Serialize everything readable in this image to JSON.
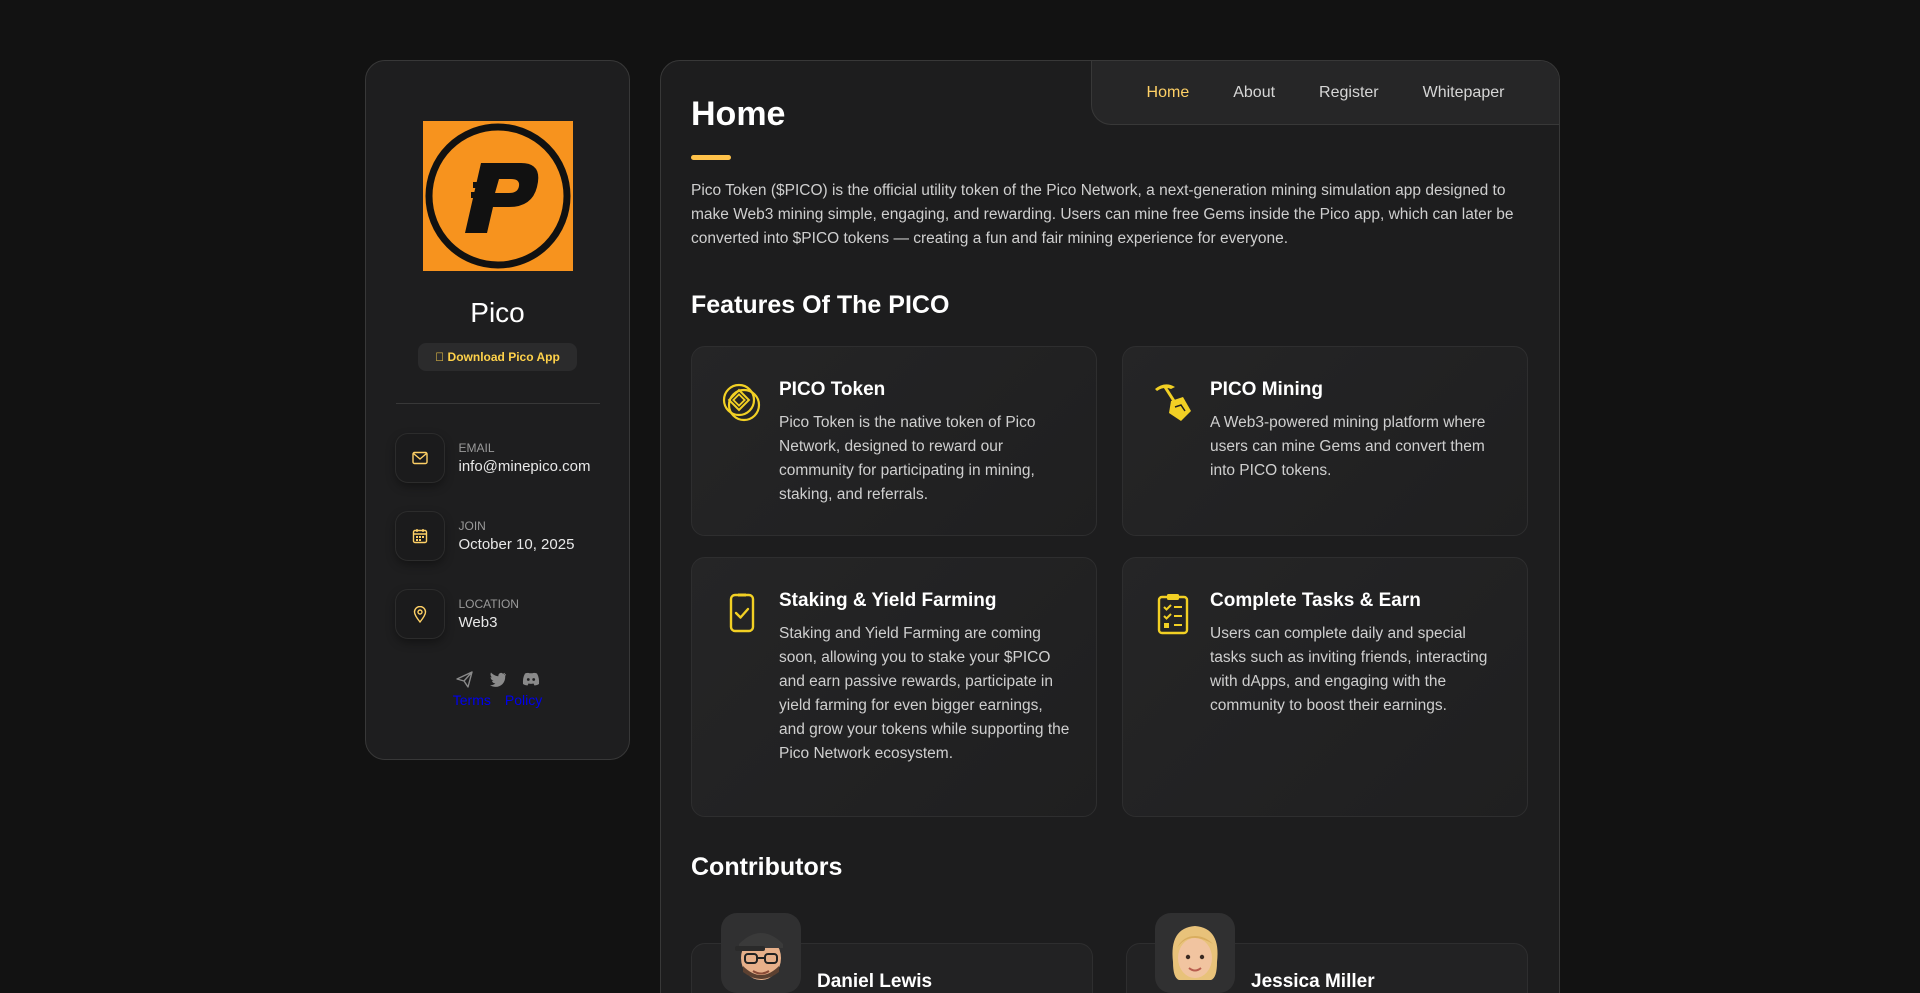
{
  "profile": {
    "name": "Pico",
    "download_label": " Download Pico App",
    "contacts": [
      {
        "title": "EMAIL",
        "value": "info@minepico.com",
        "icon": "mail-icon"
      },
      {
        "title": "JOIN",
        "value": "October 10, 2025",
        "icon": "calendar-icon"
      },
      {
        "title": "LOCATION",
        "value": "Web3",
        "icon": "location-pin-icon"
      }
    ],
    "socials": [
      "telegram-icon",
      "twitter-icon",
      "discord-icon"
    ],
    "legal": {
      "terms": "Terms",
      "policy": "Policy"
    }
  },
  "nav": {
    "items": [
      "Home",
      "About",
      "Register",
      "Whitepaper"
    ],
    "active": "Home"
  },
  "main": {
    "title": "Home",
    "intro": "Pico Token ($PICO) is the official utility token of the Pico Network, a next-generation mining simulation app designed to make Web3 mining simple, engaging, and rewarding. Users can mine free Gems inside the Pico app, which can later be converted into $PICO tokens — creating a fun and fair mining experience for everyone.",
    "features_title": "Features Of The PICO",
    "features": [
      {
        "title": "PICO Token",
        "text": "Pico Token is the native token of Pico Network, designed to reward our community for participating in mining, staking, and referrals.",
        "icon": "coins-icon"
      },
      {
        "title": "PICO Mining",
        "text": "A Web3-powered mining platform where users can mine Gems and convert them into PICO tokens.",
        "icon": "pickaxe-icon"
      },
      {
        "title": "Staking & Yield Farming",
        "text": "Staking and Yield Farming are coming soon, allowing you to stake your $PICO and earn passive rewards, participate in yield farming for even bigger earnings, and grow your tokens while supporting the Pico Network ecosystem.",
        "icon": "phone-check-icon"
      },
      {
        "title": "Complete Tasks & Earn",
        "text": "Users can complete daily and special tasks such as inviting friends, interacting with dApps, and engaging with the community to boost their earnings.",
        "icon": "checklist-icon"
      }
    ],
    "contributors_title": "Contributors",
    "contributors": [
      {
        "name": "Daniel Lewis",
        "avatar": "man-cap-glasses-avatar"
      },
      {
        "name": "Jessica Miller",
        "avatar": "woman-blonde-avatar"
      }
    ]
  },
  "colors": {
    "accent": "#ffd166",
    "brand_orange": "#f7931e",
    "icon_yellow": "#f2d024",
    "background": "#121212",
    "card": "#1d1d1e"
  }
}
